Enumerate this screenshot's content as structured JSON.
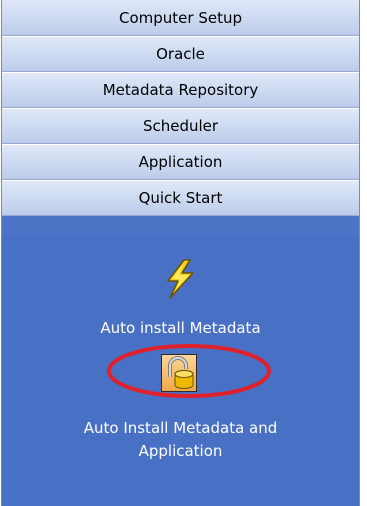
{
  "menu": {
    "items": [
      {
        "label": "Computer Setup"
      },
      {
        "label": "Oracle"
      },
      {
        "label": "Metadata Repository"
      },
      {
        "label": "Scheduler"
      },
      {
        "label": "Application"
      },
      {
        "label": "Quick Start"
      }
    ]
  },
  "tools": {
    "auto_install_metadata": {
      "label": "Auto install Metadata",
      "icon": "lightning-icon"
    },
    "auto_install_metadata_app": {
      "label_line1": "Auto Install Metadata and",
      "label_line2": "Application",
      "icon": "lock-database-icon"
    }
  },
  "colors": {
    "panel_bg": "#4870c4",
    "button_bg": "#ccd9f1",
    "highlight": "#e0202a"
  }
}
